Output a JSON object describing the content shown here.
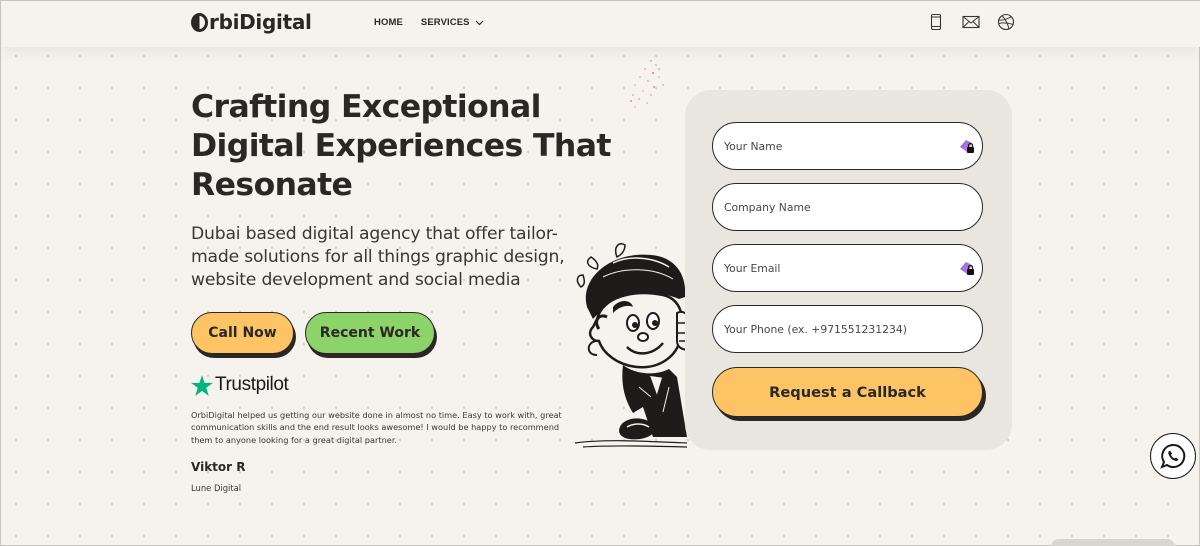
{
  "header": {
    "logo_text": "rbiDigital",
    "logo_initial_icon": "half-circle-o-icon",
    "nav": [
      {
        "label": "HOME"
      },
      {
        "label": "SERVICES",
        "icon": "chevron-down-icon"
      }
    ],
    "icons": [
      "phone-icon",
      "mail-icon",
      "dribbble-icon"
    ]
  },
  "hero": {
    "title_lines": [
      "Crafting Exceptional",
      "Digital Experiences That",
      "Resonate"
    ],
    "subtitle": "Dubai based digital agency that offer tailor-made solutions for all things graphic design, website development and social media",
    "buttons": {
      "call": {
        "label": "Call Now",
        "color": "#fcc464"
      },
      "work": {
        "label": "Recent Work",
        "color": "#8cd36a"
      }
    }
  },
  "testimonial": {
    "source": "Trustpilot",
    "source_icon": "trustpilot-star-icon",
    "source_color": "#00b67a",
    "text": "OrbiDigital helped us getting our website done in almost no time. Easy to work with, great communication skills and the end result looks awesome! I would be happy to recommend them to anyone looking for a great digital partner.",
    "name": "Viktor R",
    "company": "Lune Digital"
  },
  "form": {
    "fields": [
      {
        "placeholder": "Your Name",
        "value": "",
        "autofill_icon": true
      },
      {
        "placeholder": "Company Name",
        "value": "",
        "autofill_icon": false
      },
      {
        "placeholder": "Your Email",
        "value": "",
        "autofill_icon": true
      },
      {
        "placeholder": "Your Phone (ex. +971551231234)",
        "value": "",
        "autofill_icon": false
      }
    ],
    "submit_label": "Request a Callback",
    "submit_color": "#fcc464"
  },
  "floating": {
    "whatsapp_icon": "whatsapp-icon"
  },
  "colors": {
    "background": "#f6f3ee",
    "ink": "#2a2725",
    "card": "#e9e5df"
  }
}
